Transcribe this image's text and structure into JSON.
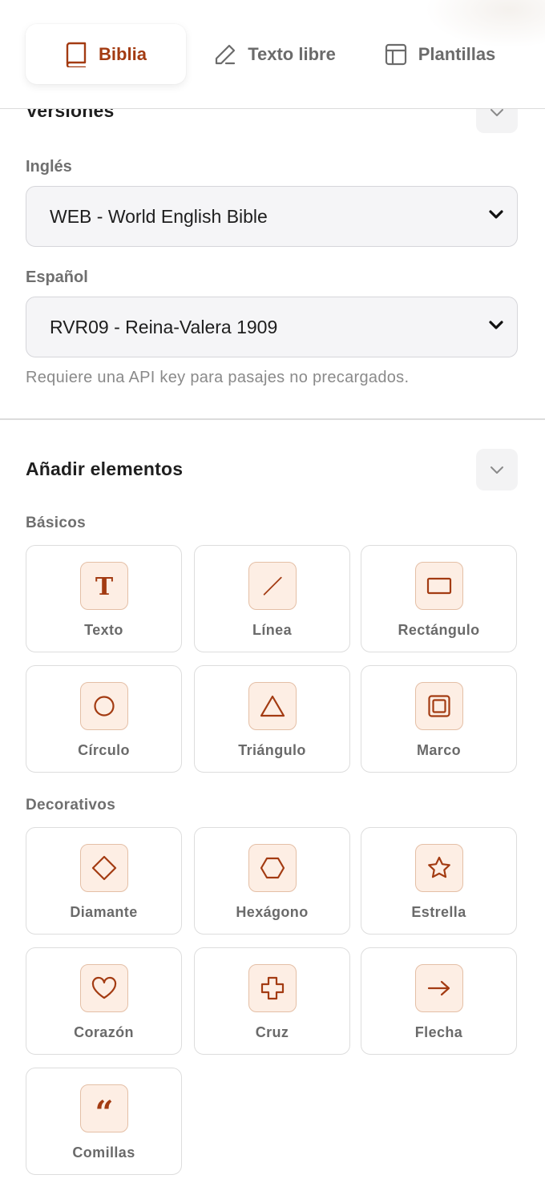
{
  "tabs": [
    {
      "label": "Biblia",
      "icon": "book-icon",
      "active": true
    },
    {
      "label": "Texto libre",
      "icon": "pencil-icon",
      "active": false
    },
    {
      "label": "Plantillas",
      "icon": "layout-icon",
      "active": false
    }
  ],
  "versions": {
    "title": "Versiones",
    "english": {
      "label": "Inglés",
      "value": "WEB - World English Bible"
    },
    "spanish": {
      "label": "Español",
      "value": "RVR09 - Reina-Valera 1909"
    },
    "hint": "Requiere una API key para pasajes no precargados."
  },
  "elements": {
    "title": "Añadir elementos",
    "basic_label": "Básicos",
    "basic": [
      {
        "label": "Texto",
        "icon": "text-icon"
      },
      {
        "label": "Línea",
        "icon": "line-icon"
      },
      {
        "label": "Rectángulo",
        "icon": "rectangle-icon"
      },
      {
        "label": "Círculo",
        "icon": "circle-icon"
      },
      {
        "label": "Triángulo",
        "icon": "triangle-icon"
      },
      {
        "label": "Marco",
        "icon": "frame-icon"
      }
    ],
    "decorative_label": "Decorativos",
    "decorative": [
      {
        "label": "Diamante",
        "icon": "diamond-icon"
      },
      {
        "label": "Hexágono",
        "icon": "hexagon-icon"
      },
      {
        "label": "Estrella",
        "icon": "star-icon"
      },
      {
        "label": "Corazón",
        "icon": "heart-icon"
      },
      {
        "label": "Cruz",
        "icon": "cross-icon"
      },
      {
        "label": "Flecha",
        "icon": "arrow-right-icon"
      },
      {
        "label": "Comillas",
        "icon": "quote-icon"
      }
    ]
  },
  "colors": {
    "accent": "#a33b12",
    "icon_bg": "#fdeee4",
    "icon_border": "#e4bfa6"
  }
}
